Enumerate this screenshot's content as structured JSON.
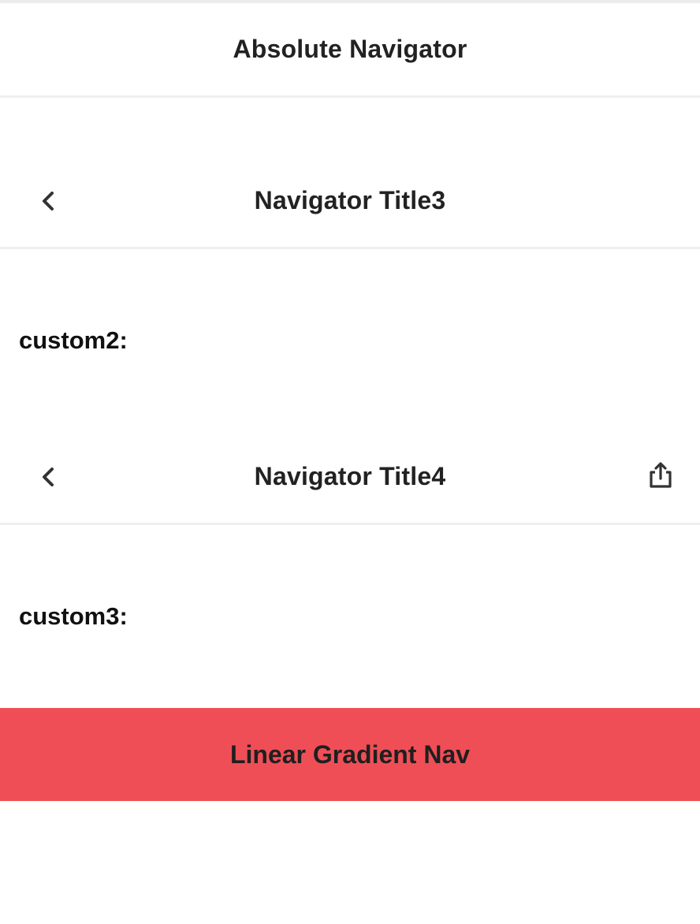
{
  "absolute_nav": {
    "title": "Absolute Navigator"
  },
  "nav_title3": {
    "title": "Navigator Title3",
    "back_icon": "chevron-left-icon"
  },
  "custom2": {
    "label": "custom2:"
  },
  "nav_title4": {
    "title": "Navigator Title4",
    "back_icon": "chevron-left-icon",
    "right_icon": "share-icon"
  },
  "custom3": {
    "label": "custom3:"
  },
  "gradient_nav": {
    "title": "Linear Gradient Nav",
    "background_color": "#f04e56"
  },
  "colors": {
    "text": "#222222",
    "divider": "#efefef",
    "background": "#ffffff"
  }
}
